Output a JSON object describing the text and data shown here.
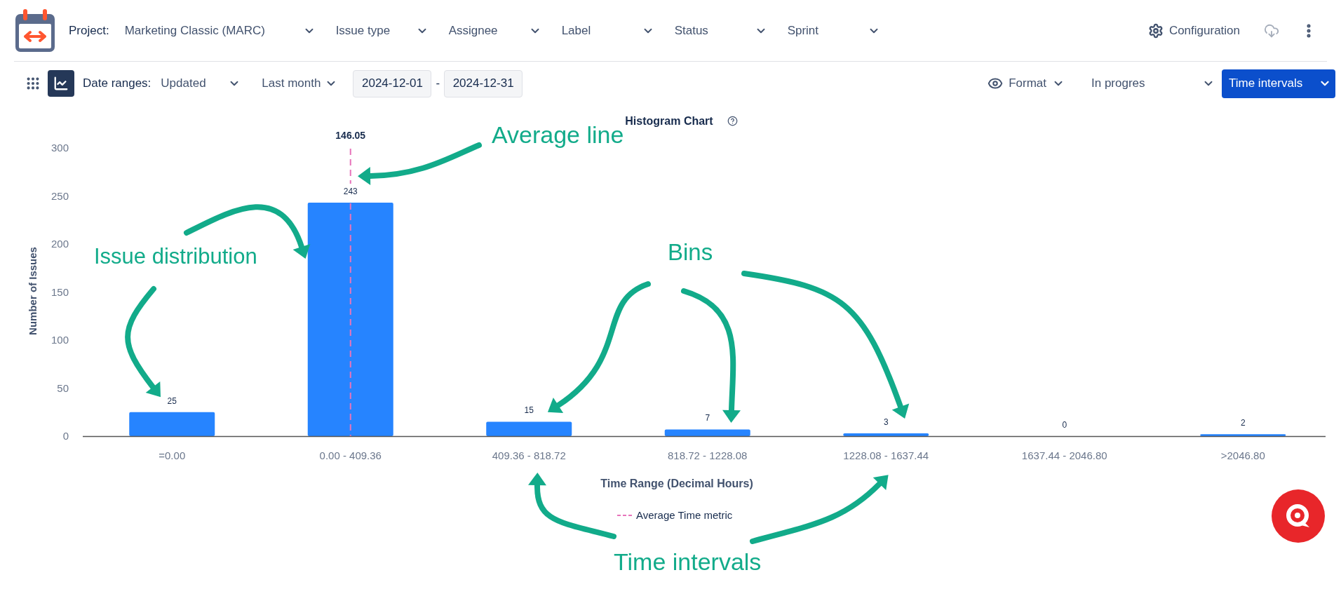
{
  "header": {
    "project_label": "Project:",
    "filters": [
      {
        "label": "Marketing Classic (MARC)"
      },
      {
        "label": "Issue type"
      },
      {
        "label": "Assignee"
      },
      {
        "label": "Label"
      },
      {
        "label": "Status"
      },
      {
        "label": "Sprint"
      }
    ],
    "configuration": "Configuration"
  },
  "toolbar": {
    "view_toggle": [
      {
        "kind": "grid",
        "selected": false
      },
      {
        "kind": "chart",
        "selected": true
      }
    ],
    "date_ranges_label": "Date ranges:",
    "date_field": "Updated",
    "period": "Last month",
    "start_date": "2024-12-01",
    "separator": "-",
    "end_date": "2024-12-31",
    "format": "Format",
    "status_filter": "In progres",
    "view_button": "Time intervals"
  },
  "chart": {
    "chart_data": {
      "type": "bar",
      "title": "Histogram Chart",
      "xlabel": "Time Range (Decimal Hours)",
      "ylabel": "Number of Issues",
      "categories": [
        "=0.00",
        "0.00 - 409.36",
        "409.36 - 818.72",
        "818.72 - 1228.08",
        "1228.08 - 1637.44",
        "1637.44 - 2046.80",
        ">2046.80"
      ],
      "values": [
        25,
        243,
        15,
        7,
        3,
        0,
        2
      ],
      "ylim": [
        0,
        300
      ],
      "yticks": [
        0,
        50,
        100,
        150,
        200,
        250,
        300
      ],
      "data_labels": true
    },
    "average_value_label": "146.05",
    "legend": "Average Time metric"
  },
  "callouts": [
    {
      "text": "Average line"
    },
    {
      "text": "Issue distribution"
    },
    {
      "text": "Bins"
    },
    {
      "text": "Time intervals"
    }
  ]
}
